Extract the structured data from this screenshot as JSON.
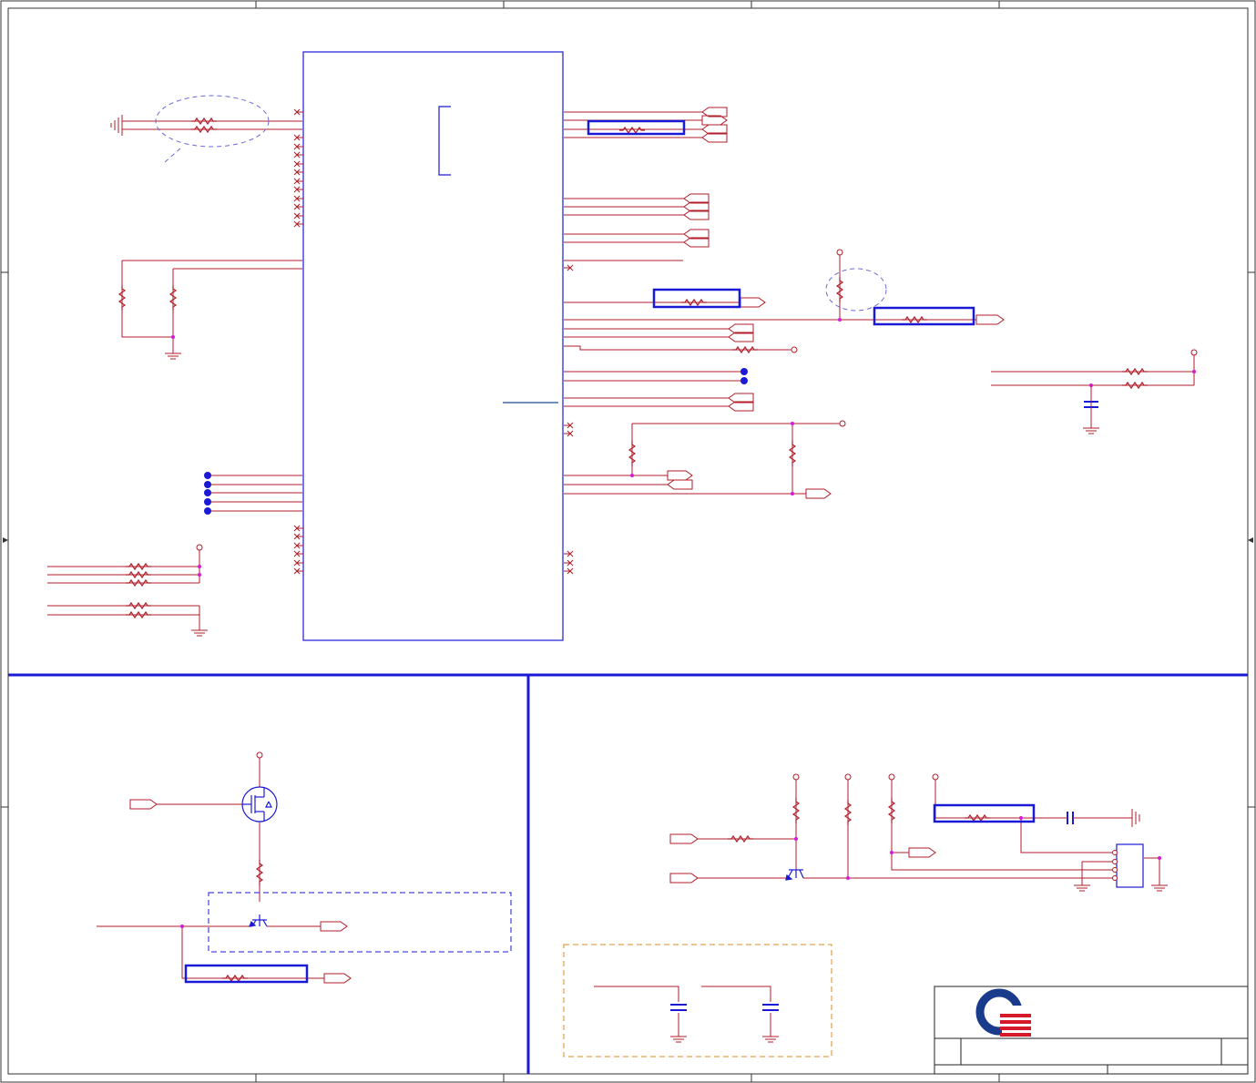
{
  "sheet": {
    "title": "",
    "page": "",
    "revision": "",
    "doc_number": ""
  },
  "colors": {
    "wire": "#b01c28",
    "component": "#1a1ad6",
    "border": "#222222",
    "junction": "#d41ad4",
    "divider": "#1a1ad6",
    "highlight_box": "#1a1ad6",
    "dashed_annotation": "#6a6ad6",
    "rf_box": "#e08a20",
    "logo_blue": "#1a3a8c",
    "logo_red": "#d41a2a"
  },
  "sections": [
    {
      "name": "main-ic-region"
    },
    {
      "name": "power-switch-region"
    },
    {
      "name": "transistor-driver-region"
    },
    {
      "name": "decoupling-region"
    }
  ],
  "icons": [
    "resistor-icon",
    "capacitor-icon",
    "ground-icon",
    "mosfet-icon",
    "npn-transistor-icon",
    "off-page-connector-icon",
    "power-pin-icon",
    "test-point-icon",
    "no-connect-icon",
    "company-logo-icon"
  ]
}
